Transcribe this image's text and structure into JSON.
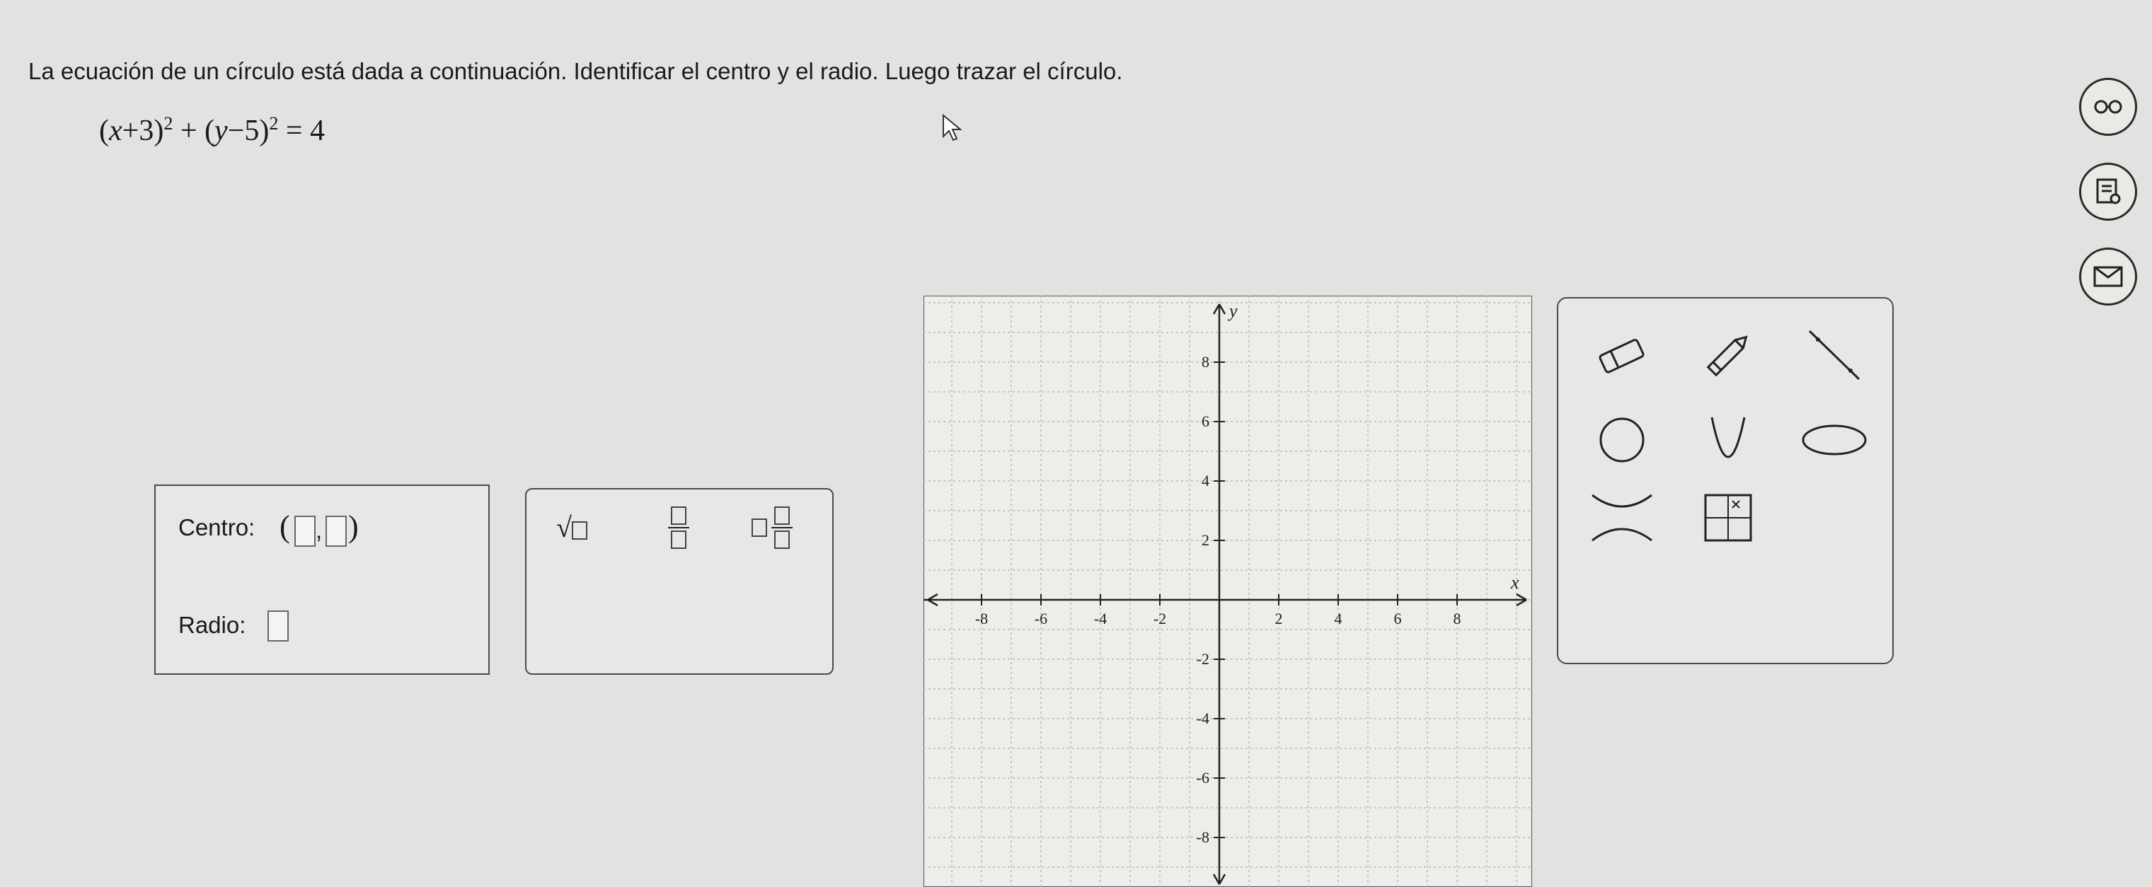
{
  "question": "La ecuación de un círculo está dada a continuación. Identificar el centro y el radio. Luego trazar el círculo.",
  "equation": {
    "a": "x",
    "a_op": "+",
    "a_num": "3",
    "b": "y",
    "b_op": "−",
    "b_num": "5",
    "exp": "2",
    "rhs": "= 4"
  },
  "answer": {
    "center_label": "Centro:",
    "radius_label": "Radio:",
    "comma": ","
  },
  "keypad": {
    "sqrt_symbol": "√"
  },
  "side_icons": [
    "glasses-icon",
    "notes-icon",
    "message-icon"
  ],
  "tools": [
    "eraser",
    "pencil",
    "line",
    "circle",
    "parabola",
    "ellipse",
    "hyperbola",
    "point-grid"
  ],
  "chart_data": {
    "type": "scatter",
    "xlabel": "x",
    "ylabel": "y",
    "xlim": [
      -10,
      10
    ],
    "ylim": [
      -10,
      10
    ],
    "x_ticks": [
      -8,
      -6,
      -4,
      -2,
      2,
      4,
      6,
      8
    ],
    "y_ticks": [
      8,
      6,
      4,
      2,
      -2,
      -4,
      -6,
      -8
    ],
    "grid": true,
    "series": []
  }
}
